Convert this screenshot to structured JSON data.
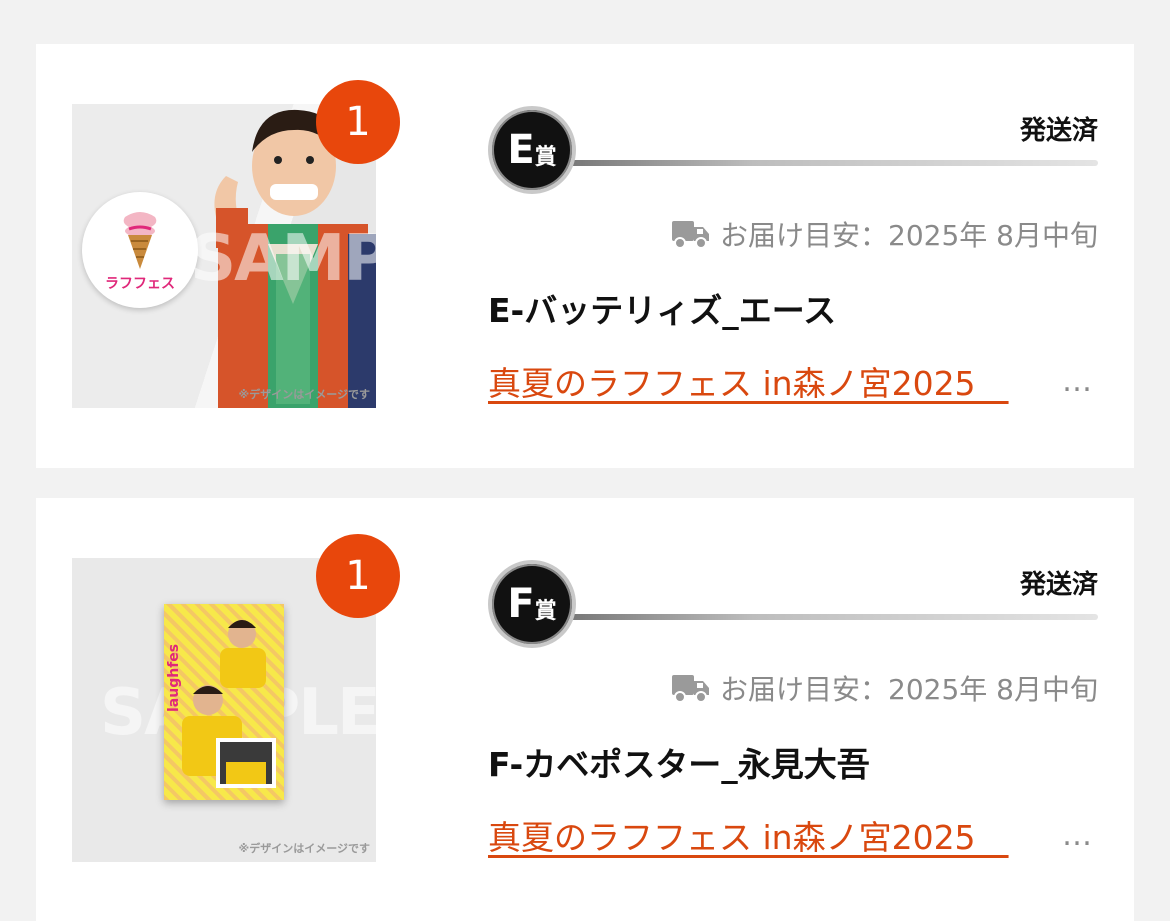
{
  "orders": [
    {
      "quantity": "1",
      "prize_letter": "E",
      "prize_suffix": "賞",
      "status": "発送済",
      "delivery_label": "お届け目安：2025年 8月中旬",
      "item_name": "E-バッテリィズ_エース",
      "event_link": "真夏のラフフェス in森ノ宮2025　",
      "ellipsis": "…",
      "image_note": "※デザインはイメージです",
      "watermark": "SAMPLE",
      "pin_label": "ラフフェス"
    },
    {
      "quantity": "1",
      "prize_letter": "F",
      "prize_suffix": "賞",
      "status": "発送済",
      "delivery_label": "お届け目安：2025年 8月中旬",
      "item_name": "F-カベポスター_永見大吾",
      "event_link": "真夏のラフフェス in森ノ宮2025　",
      "ellipsis": "…",
      "image_note": "※デザインはイメージです",
      "watermark": "SAMPLE",
      "poster_label": "laughfes"
    }
  ],
  "colors": {
    "accent": "#e8470c",
    "link": "#d9480f",
    "background": "#f2f2f2",
    "card": "#ffffff",
    "muted": "#8a8a8a"
  },
  "icons": {
    "delivery": "truck-icon"
  }
}
